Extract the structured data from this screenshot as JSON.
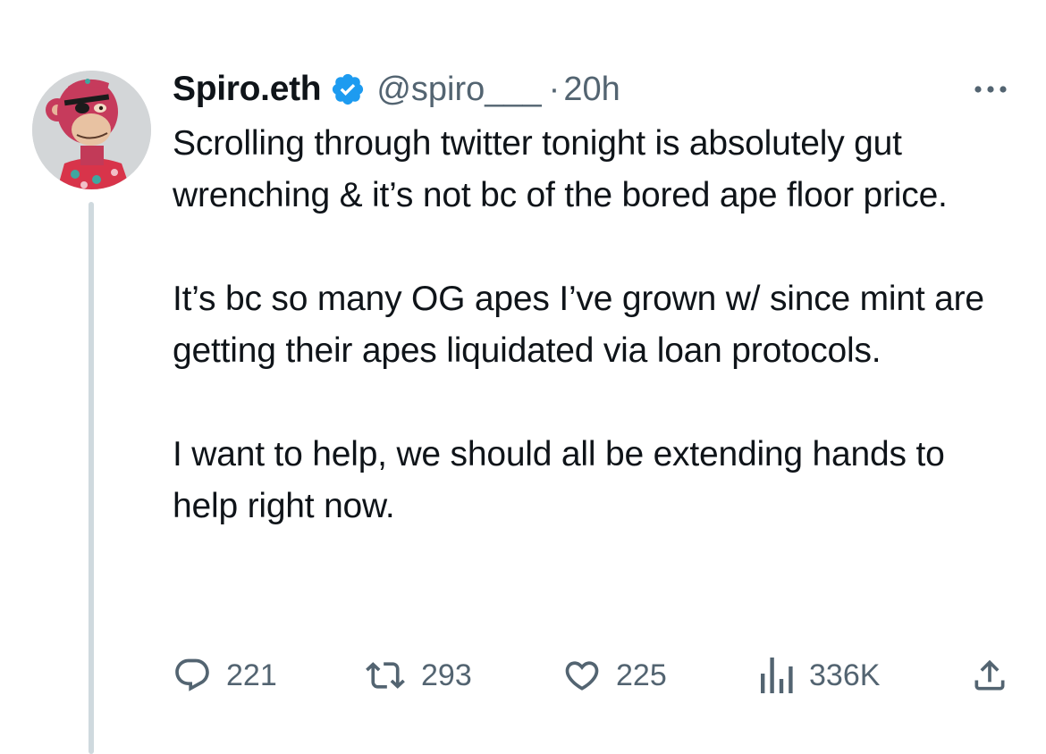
{
  "tweet": {
    "author": {
      "display_name": "Spiro.eth",
      "handle": "@spiro___",
      "verified": true,
      "avatar": "bored-ape-avatar"
    },
    "separator": "·",
    "timestamp": "20h",
    "body": [
      "Scrolling through twitter tonight is absolutely gut wrenching & it’s not bc of the bored ape floor price.",
      "It’s bc so many OG apes I’ve grown w/ since mint are getting their apes liquidated via loan protocols.",
      "I want to help, we should all be extending hands to help right now."
    ],
    "actions": {
      "replies": "221",
      "retweets": "293",
      "likes": "225",
      "views": "336K"
    },
    "icons": {
      "verified": "verified-badge-icon",
      "more": "more-options-icon",
      "reply": "reply-icon",
      "retweet": "retweet-icon",
      "like": "heart-icon",
      "views": "views-chart-icon",
      "share": "share-icon"
    }
  },
  "colors": {
    "text": "#0f1419",
    "secondary": "#536471",
    "verified": "#1d9bf0",
    "thread_line": "#cfd9de"
  }
}
